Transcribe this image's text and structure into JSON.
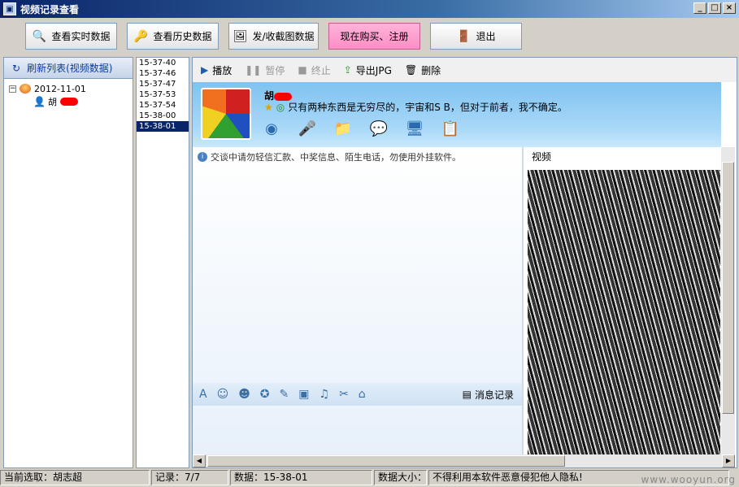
{
  "window": {
    "title": "视频记录查看",
    "min_glyph": "_",
    "max_glyph": "□",
    "close_glyph": "×"
  },
  "toolbar": {
    "realtime": "查看实时数据",
    "history": "查看历史数据",
    "screenshots": "发/收截图数据",
    "buy": "现在购买、注册",
    "exit": "退出"
  },
  "left_panel": {
    "refresh": "刷新列表(视频数据)",
    "tree": {
      "date": "2012-11-01",
      "contact": "胡"
    }
  },
  "times": [
    "15-37-40",
    "15-37-46",
    "15-37-47",
    "15-37-53",
    "15-37-54",
    "15-38-00",
    "15-38-01"
  ],
  "selected_time_index": 6,
  "player": {
    "play": "播放",
    "pause": "暂停",
    "stop": "终止",
    "export": "导出JPG",
    "delete": "删除"
  },
  "qq": {
    "name": "胡",
    "signature": "只有两种东西是无穷尽的，宇宙和S B，但对于前者，我不确定。",
    "notice": "交谈中请勿轻信汇款、中奖信息、陌生电话，勿使用外挂软件。",
    "history_label": "消息记录",
    "video_label": "视频"
  },
  "status": {
    "current": "当前选取：胡志超",
    "records": "记录：7/7",
    "data": "数据：15-38-01",
    "size": "数据大小：",
    "warning": "不得利用本软件恶意侵犯他人隐私!"
  },
  "watermark": "www.wooyun.org",
  "colors": {
    "title_blue": "#0a246a",
    "buy_pink": "#ff8ec6",
    "qq_blue": "#7fc2f0"
  }
}
